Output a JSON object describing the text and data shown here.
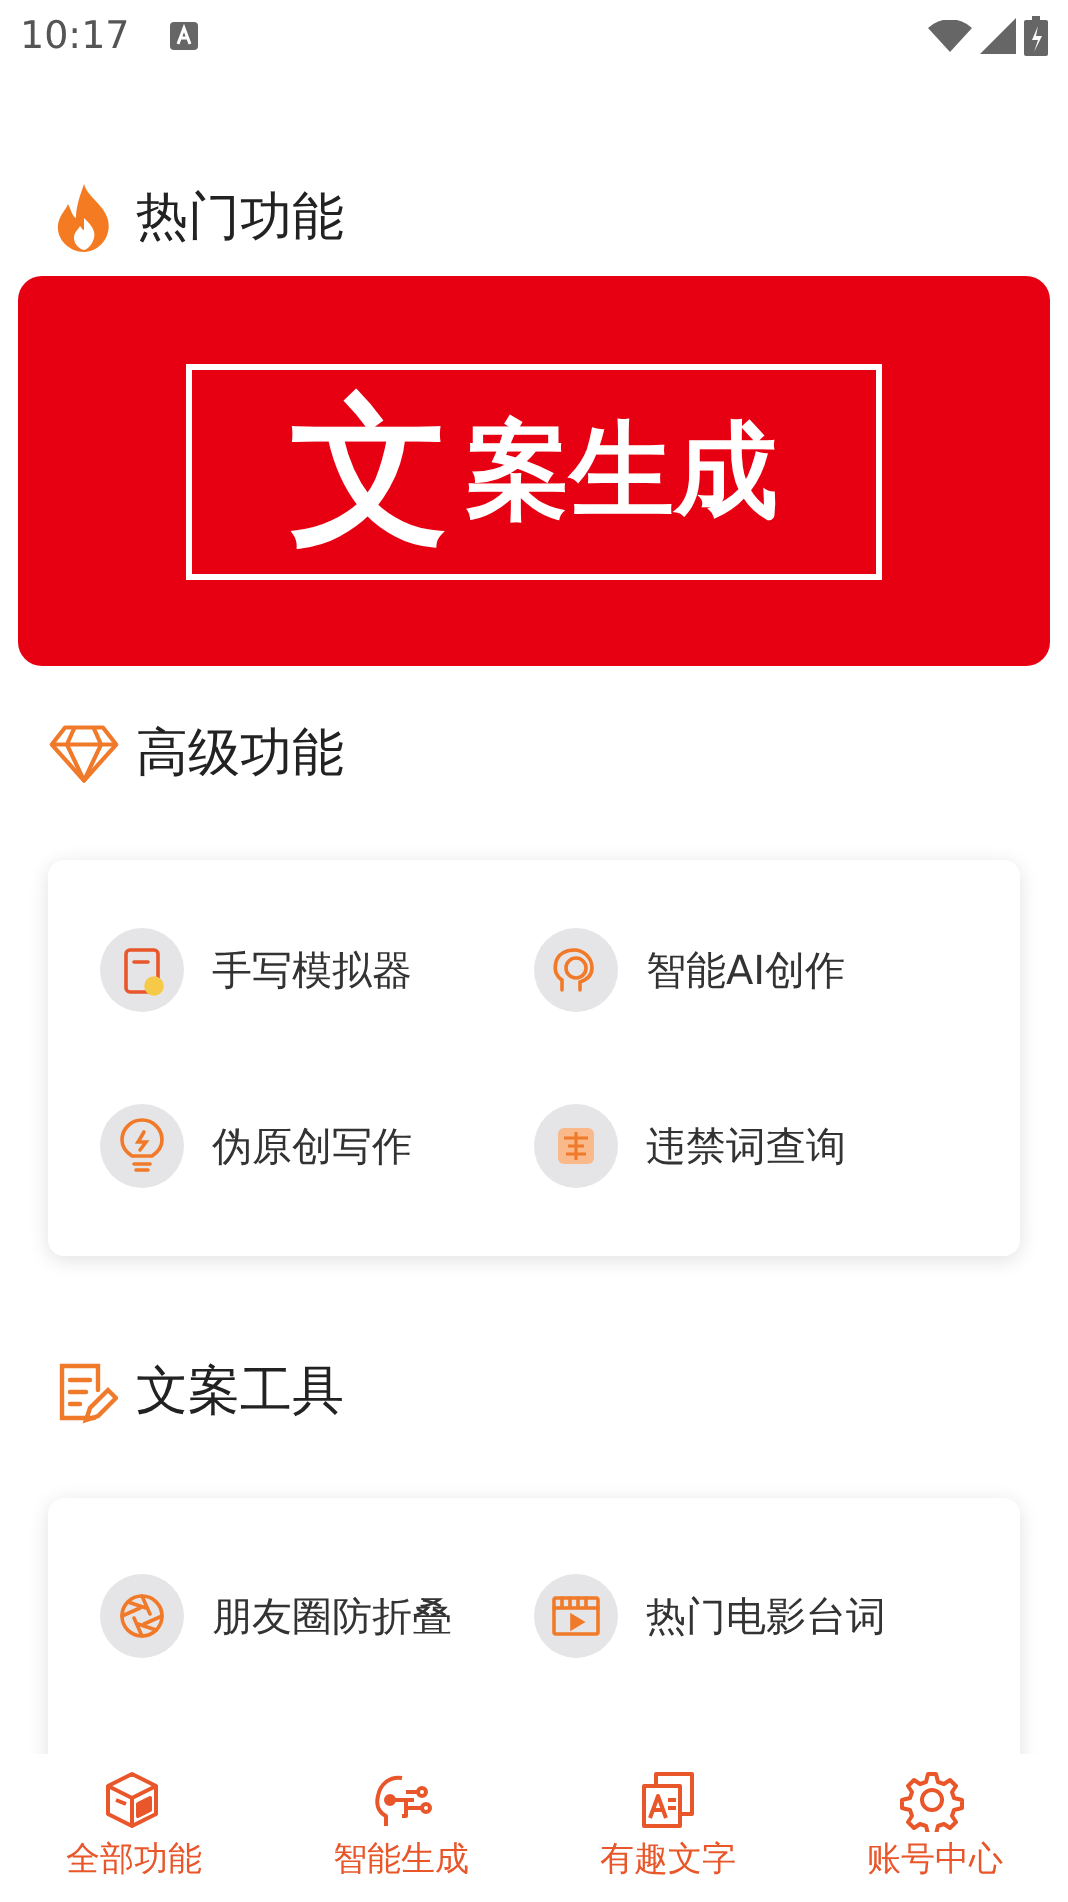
{
  "status_bar": {
    "time": "10:17"
  },
  "sections": [
    {
      "title": "热门功能",
      "kind": "banner",
      "banner": {
        "big": "文",
        "rest": "案生成"
      }
    },
    {
      "title": "高级功能",
      "kind": "grid",
      "items": [
        {
          "label": "手写模拟器"
        },
        {
          "label": "智能AI创作"
        },
        {
          "label": "伪原创写作"
        },
        {
          "label": "违禁词查询"
        }
      ]
    },
    {
      "title": "文案工具",
      "kind": "grid",
      "items": [
        {
          "label": "朋友圈防折叠"
        },
        {
          "label": "热门电影台词"
        }
      ]
    }
  ],
  "bottom_nav": [
    {
      "label": "全部功能"
    },
    {
      "label": "智能生成"
    },
    {
      "label": "有趣文字"
    },
    {
      "label": "账号中心"
    }
  ]
}
